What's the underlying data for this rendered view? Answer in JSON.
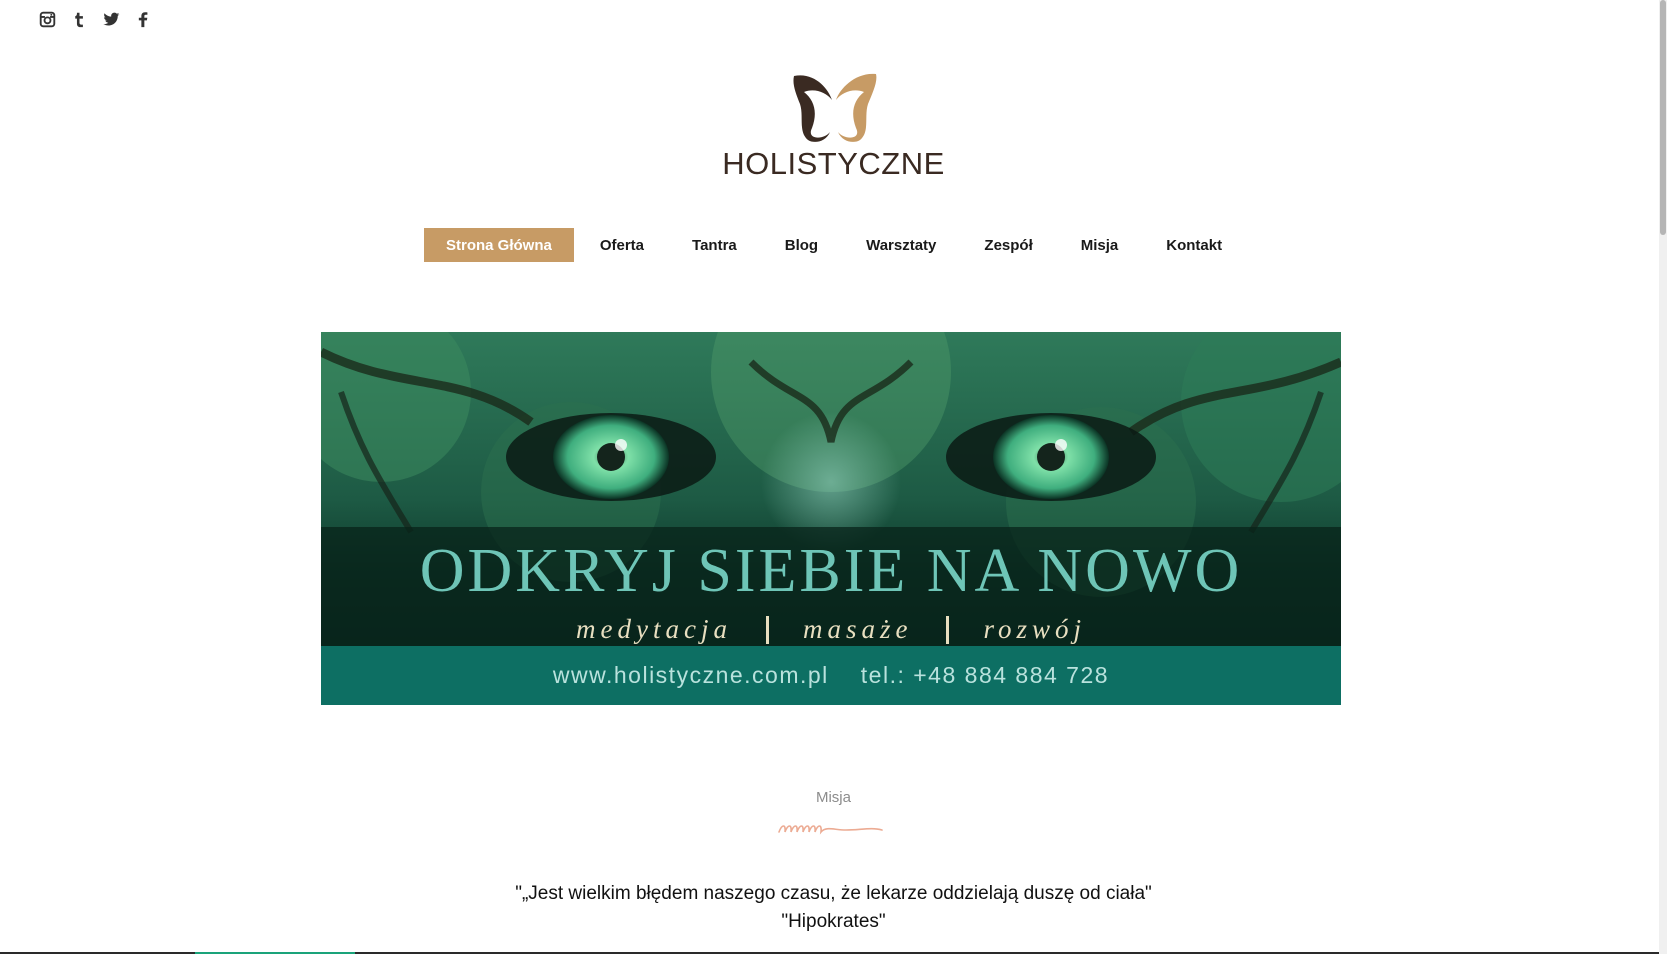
{
  "social": [
    {
      "name": "instagram-icon"
    },
    {
      "name": "tumblr-icon"
    },
    {
      "name": "twitter-icon"
    },
    {
      "name": "facebook-icon"
    }
  ],
  "logo": {
    "text": "HOLISTYCZNE",
    "colors": {
      "dark": "#3a2a22",
      "gold": "#c79b65"
    }
  },
  "nav": {
    "items": [
      {
        "label": "Strona Główna",
        "active": true
      },
      {
        "label": "Oferta"
      },
      {
        "label": "Tantra"
      },
      {
        "label": "Blog"
      },
      {
        "label": "Warsztaty"
      },
      {
        "label": "Zespół"
      },
      {
        "label": "Misja"
      },
      {
        "label": "Kontakt"
      }
    ],
    "accent_color": "#c79b65"
  },
  "banner": {
    "title": "ODKRYJ SIEBIE NA NOWO",
    "subtitles": [
      "medytacja",
      "masaże",
      "rozwój"
    ],
    "website": "www.holistyczne.com.pl",
    "phone": "tel.: +48 884 884 728"
  },
  "mission": {
    "label": "Misja",
    "quote_line1": "\"„Jest wielkim błędem naszego czasu, że lekarze oddzielają duszę od ciała\"",
    "quote_line2": "\"Hipokrates\""
  }
}
